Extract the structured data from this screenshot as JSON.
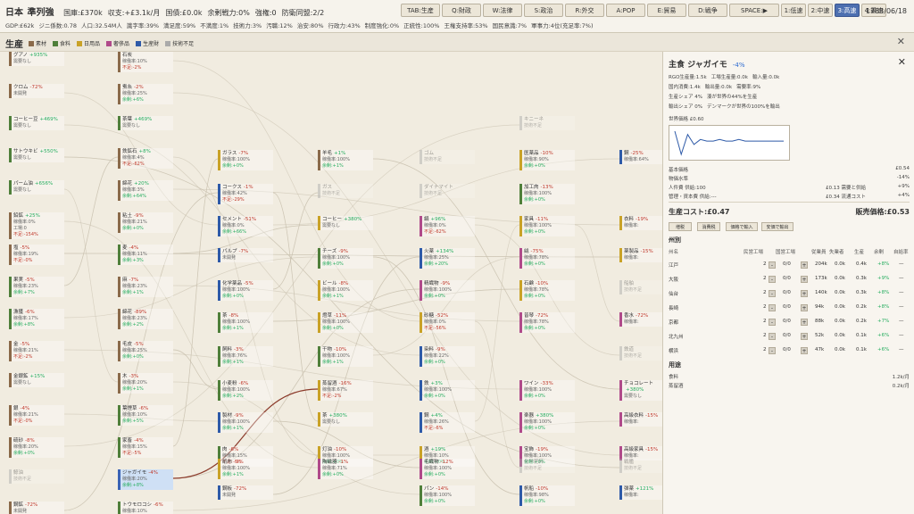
{
  "header": {
    "country": "日本",
    "rank": "準列強",
    "stats": [
      "国庫:£370k",
      "収支:+£3.1k/月",
      "国債:£0.0k",
      "余剰戦力:0%",
      "強権:0",
      "防衛同盟:2/2"
    ],
    "sub_stats": [
      "GDP:£62k",
      "ジニ係数:0.78",
      "人口:32.54M人",
      "識字率:39%",
      "満足度:59%",
      "不満度:1%",
      "技術力:3%",
      "汚職:12%",
      "治安:80%",
      "行政力:43%",
      "制度強化:0%",
      "正統性:100%",
      "王権支持率:53%",
      "国民意識:7%",
      "軍事力:4位(充足率:7%)"
    ],
    "buttons": [
      "TAB:生産",
      "Q:財政",
      "W:法律",
      "S:政治",
      "R:外交",
      "A:POP",
      "E:貿易",
      "D:戦争",
      "SPACE:▶",
      "1:低速",
      "2:中速",
      "3:高速",
      "4:最速"
    ],
    "active_button": "3:高速",
    "date": "1783/06/18"
  },
  "section": {
    "title": "生産",
    "legend": [
      {
        "label": "素材",
        "color": "#8a6a4a"
      },
      {
        "label": "食料",
        "color": "#4f7f3a"
      },
      {
        "label": "日用品",
        "color": "#c9a227"
      },
      {
        "label": "奢侈品",
        "color": "#b04a8a"
      },
      {
        "label": "生産財",
        "color": "#2e5aa8"
      },
      {
        "label": "技術不足",
        "color": "#aaaaaa"
      }
    ],
    "close": "✕"
  },
  "nodes": [
    {
      "name": "グアノ",
      "delta": "+935%",
      "lines": [
        "需要なし"
      ],
      "color": "#8a6a4a",
      "col": 0,
      "row": 0
    },
    {
      "name": "クロム",
      "delta": "-72%",
      "lines": [
        "未開発"
      ],
      "color": "#8a6a4a",
      "col": 0,
      "row": 1
    },
    {
      "name": "コーヒー豆",
      "delta": "+469%",
      "lines": [
        "需要なし"
      ],
      "color": "#4f7f3a",
      "col": 0,
      "row": 2
    },
    {
      "name": "サトウキビ",
      "delta": "+550%",
      "lines": [
        "需要なし"
      ],
      "color": "#4f7f3a",
      "col": 0,
      "row": 3
    },
    {
      "name": "パーム油",
      "delta": "+656%",
      "lines": [
        "需要なし"
      ],
      "color": "#4f7f3a",
      "col": 0,
      "row": 4
    },
    {
      "name": "鉛鉱",
      "delta": "+25%",
      "lines": [
        "稼働率:0%",
        "工場:0",
        "不足:-154%"
      ],
      "color": "#8a6a4a",
      "col": 0,
      "row": 5
    },
    {
      "name": "塩",
      "delta": "-5%",
      "lines": [
        "稼働率:19%",
        "不足:-0%"
      ],
      "color": "#8a6a4a",
      "col": 0,
      "row": 6
    },
    {
      "name": "果実",
      "delta": "-5%",
      "lines": [
        "稼働率:23%",
        "余剰:+7%"
      ],
      "color": "#4f7f3a",
      "col": 0,
      "row": 7
    },
    {
      "name": "漁獲",
      "delta": "-6%",
      "lines": [
        "稼働率:17%",
        "余剰:+8%"
      ],
      "color": "#4f7f3a",
      "col": 0,
      "row": 8
    },
    {
      "name": "金",
      "delta": "-5%",
      "lines": [
        "稼働率:21%",
        "不足:-2%"
      ],
      "color": "#8a6a4a",
      "col": 0,
      "row": 9
    },
    {
      "name": "金銀鉱",
      "delta": "+15%",
      "lines": [
        "需要なし"
      ],
      "color": "#8a6a4a",
      "col": 0,
      "row": 10
    },
    {
      "name": "銀",
      "delta": "-4%",
      "lines": [
        "稼働率:21%",
        "不足:-0%"
      ],
      "color": "#8a6a4a",
      "col": 0,
      "row": 11
    },
    {
      "name": "硫砂",
      "delta": "-8%",
      "lines": [
        "稼働率:20%",
        "余剰:+0%"
      ],
      "color": "#8a6a4a",
      "col": 0,
      "row": 12
    },
    {
      "name": "鯨油",
      "delta": "",
      "lines": [
        "技術不足"
      ],
      "color": "#aaaaaa",
      "col": 0,
      "row": 13,
      "dim": true
    },
    {
      "name": "鋼鉱",
      "delta": "-72%",
      "lines": [
        "未開発"
      ],
      "color": "#8a6a4a",
      "col": 0,
      "row": 14
    },
    {
      "name": "石炭",
      "delta": "",
      "lines": [
        "稼働率:10%",
        "不足:-2%"
      ],
      "color": "#8a6a4a",
      "col": 1,
      "row": 0
    },
    {
      "name": "蚕糸",
      "delta": "-2%",
      "lines": [
        "稼働率:25%",
        "余剰:+6%"
      ],
      "color": "#8a6a4a",
      "col": 1,
      "row": 1
    },
    {
      "name": "茶葉",
      "delta": "+469%",
      "lines": [
        "需要なし"
      ],
      "color": "#4f7f3a",
      "col": 1,
      "row": 2
    },
    {
      "name": "鉄鉱石",
      "delta": "+8%",
      "lines": [
        "稼働率:4%",
        "不足:-62%"
      ],
      "color": "#8a6a4a",
      "col": 1,
      "row": 3
    },
    {
      "name": "綿花",
      "delta": "+20%",
      "lines": [
        "稼働率:3%",
        "余剰:+64%"
      ],
      "color": "#8a6a4a",
      "col": 1,
      "row": 4
    },
    {
      "name": "粘土",
      "delta": "-9%",
      "lines": [
        "稼働率:21%",
        "余剰:+0%"
      ],
      "color": "#8a6a4a",
      "col": 1,
      "row": 5
    },
    {
      "name": "麦",
      "delta": "-4%",
      "lines": [
        "稼働率:11%",
        "余剰:+3%"
      ],
      "color": "#4f7f3a",
      "col": 1,
      "row": 6
    },
    {
      "name": "麻",
      "delta": "-7%",
      "lines": [
        "稼働率:23%",
        "余剰:+1%"
      ],
      "color": "#8a6a4a",
      "col": 1,
      "row": 7
    },
    {
      "name": "綿花",
      "delta": "-89%",
      "lines": [
        "稼働率:23%",
        "余剰:+2%"
      ],
      "color": "#8a6a4a",
      "col": 1,
      "row": 8
    },
    {
      "name": "毛皮",
      "delta": "-5%",
      "lines": [
        "稼働率:25%",
        "余剰:+0%"
      ],
      "color": "#8a6a4a",
      "col": 1,
      "row": 9
    },
    {
      "name": "木",
      "delta": "-3%",
      "lines": [
        "稼働率:20%",
        "余剰:+1%"
      ],
      "color": "#8a6a4a",
      "col": 1,
      "row": 10
    },
    {
      "name": "葉煙草",
      "delta": "-6%",
      "lines": [
        "稼働率:10%",
        "余剰:+5%"
      ],
      "color": "#4f7f3a",
      "col": 1,
      "row": 11
    },
    {
      "name": "家畜",
      "delta": "-4%",
      "lines": [
        "稼働率:15%",
        "不足:-5%"
      ],
      "color": "#4f7f3a",
      "col": 1,
      "row": 12
    },
    {
      "name": "ジャガイモ",
      "delta": "-4%",
      "lines": [
        "稼働率:20%",
        "余剰:+8%"
      ],
      "color": "#3a63b5",
      "col": 1,
      "row": 13,
      "sel": true
    },
    {
      "name": "トウモロコシ",
      "delta": "-6%",
      "lines": [
        "稼働率:10%",
        "余剰:+4%"
      ],
      "color": "#4f7f3a",
      "col": 1,
      "row": 14
    },
    {
      "name": "ガラス",
      "delta": "-7%",
      "lines": [
        "稼働率:100%",
        "余剰:+0%"
      ],
      "color": "#c9a227",
      "col": 2,
      "row": 3
    },
    {
      "name": "コークス",
      "delta": "-1%",
      "lines": [
        "稼働率:42%",
        "不足:-29%"
      ],
      "color": "#2e5aa8",
      "col": 2,
      "row": 4
    },
    {
      "name": "セメント",
      "delta": "-51%",
      "lines": [
        "稼働率:0%",
        "余剰:+66%"
      ],
      "color": "#2e5aa8",
      "col": 2,
      "row": 5
    },
    {
      "name": "パルプ",
      "delta": "-7%",
      "lines": [
        "未開発"
      ],
      "color": "#2e5aa8",
      "col": 2,
      "row": 6
    },
    {
      "name": "化学薬品",
      "delta": "-5%",
      "lines": [
        "稼働率:100%",
        "余剰:+0%"
      ],
      "color": "#2e5aa8",
      "col": 2,
      "row": 7
    },
    {
      "name": "茶",
      "delta": "-8%",
      "lines": [
        "稼働率:100%",
        "余剰:+1%"
      ],
      "color": "#4f7f3a",
      "col": 2,
      "row": 8
    },
    {
      "name": "飼料",
      "delta": "-3%",
      "lines": [
        "稼働率:76%",
        "余剰:+1%"
      ],
      "color": "#4f7f3a",
      "col": 2,
      "row": 9
    },
    {
      "name": "小麦粉",
      "delta": "-6%",
      "lines": [
        "稼働率:100%",
        "余剰:+2%"
      ],
      "color": "#4f7f3a",
      "col": 2,
      "row": 10
    },
    {
      "name": "製材",
      "delta": "-9%",
      "lines": [
        "稼働率:100%",
        "余剰:+1%"
      ],
      "color": "#2e5aa8",
      "col": 2,
      "row": 11
    },
    {
      "name": "肉",
      "delta": "-6%",
      "lines": [
        "稼働率:15%",
        "不足:-5%"
      ],
      "color": "#4f7f3a",
      "col": 2,
      "row": 12
    },
    {
      "name": "紙布",
      "delta": "-9%",
      "lines": [
        "稼働率:100%",
        "余剰:+1%"
      ],
      "color": "#c9a227",
      "col": 2,
      "row": 13
    },
    {
      "name": "鋼板",
      "delta": "-72%",
      "lines": [
        "未開発"
      ],
      "color": "#2e5aa8",
      "col": 2,
      "row": 14
    },
    {
      "name": "羊毛",
      "delta": "+1%",
      "lines": [
        "稼働率:100%",
        "余剰:+1%"
      ],
      "color": "#8a6a4a",
      "col": 3,
      "row": 3
    },
    {
      "name": "ガス",
      "delta": "",
      "lines": [
        "技術不足"
      ],
      "color": "#aaaaaa",
      "col": 3,
      "row": 4,
      "dim": true
    },
    {
      "name": "コーヒー",
      "delta": "+380%",
      "lines": [
        "需要なし"
      ],
      "color": "#c9a227",
      "col": 3,
      "row": 5
    },
    {
      "name": "チーズ",
      "delta": "-9%",
      "lines": [
        "稼働率:100%",
        "余剰:+0%"
      ],
      "color": "#4f7f3a",
      "col": 3,
      "row": 6
    },
    {
      "name": "ビール",
      "delta": "-8%",
      "lines": [
        "稼働率:100%",
        "余剰:+1%"
      ],
      "color": "#c9a227",
      "col": 3,
      "row": 7
    },
    {
      "name": "燈草",
      "delta": "-11%",
      "lines": [
        "稼働率:100%",
        "余剰:+0%"
      ],
      "color": "#c9a227",
      "col": 3,
      "row": 8
    },
    {
      "name": "干物",
      "delta": "-10%",
      "lines": [
        "稼働率:100%",
        "余剰:+1%"
      ],
      "color": "#4f7f3a",
      "col": 3,
      "row": 9
    },
    {
      "name": "蒸留酒",
      "delta": "-16%",
      "lines": [
        "稼働率:67%",
        "不足:-2%"
      ],
      "color": "#c9a227",
      "col": 3,
      "row": 10
    },
    {
      "name": "茶",
      "delta": "+380%",
      "lines": [
        "需要なし"
      ],
      "color": "#c9a227",
      "col": 3,
      "row": 11
    },
    {
      "name": "灯油",
      "delta": "-10%",
      "lines": [
        "稼働率:100%",
        "余剰:+0%"
      ],
      "color": "#c9a227",
      "col": 3,
      "row": 12
    },
    {
      "name": "陶磁器",
      "delta": "-1%",
      "lines": [
        "稼働率:71%",
        "余剰:+0%"
      ],
      "color": "#b04a8a",
      "col": 3,
      "row": 13
    },
    {
      "name": "ゴム",
      "delta": "",
      "lines": [
        "技術不足"
      ],
      "color": "#aaaaaa",
      "col": 4,
      "row": 3,
      "dim": true
    },
    {
      "name": "ダイナマイト",
      "delta": "",
      "lines": [
        "技術不足"
      ],
      "color": "#aaaaaa",
      "col": 4,
      "row": 4,
      "dim": true
    },
    {
      "name": "絹",
      "delta": "+96%",
      "lines": [
        "稼働率:0%",
        "不足:-62%"
      ],
      "color": "#b04a8a",
      "col": 4,
      "row": 5
    },
    {
      "name": "火薬",
      "delta": "+134%",
      "lines": [
        "稼働率:25%",
        "余剰:+20%"
      ],
      "color": "#2e5aa8",
      "col": 4,
      "row": 6
    },
    {
      "name": "精織物",
      "delta": "-9%",
      "lines": [
        "稼働率:100%",
        "余剰:+0%"
      ],
      "color": "#b04a8a",
      "col": 4,
      "row": 7
    },
    {
      "name": "砂糖",
      "delta": "-52%",
      "lines": [
        "稼働率:0%",
        "不足:-56%"
      ],
      "color": "#c9a227",
      "col": 4,
      "row": 8
    },
    {
      "name": "染料",
      "delta": "-9%",
      "lines": [
        "稼働率:22%",
        "余剰:+0%"
      ],
      "color": "#2e5aa8",
      "col": 4,
      "row": 9
    },
    {
      "name": "鉄",
      "delta": "+3%",
      "lines": [
        "稼働率:100%",
        "余剰:+0%"
      ],
      "color": "#2e5aa8",
      "col": 4,
      "row": 10
    },
    {
      "name": "鋼",
      "delta": "+4%",
      "lines": [
        "稼働率:26%",
        "不足:-6%"
      ],
      "color": "#2e5aa8",
      "col": 4,
      "row": 11
    },
    {
      "name": "酒",
      "delta": "+19%",
      "lines": [
        "稼働率:10%",
        "余剰:+0%"
      ],
      "color": "#c9a227",
      "col": 4,
      "row": 12
    },
    {
      "name": "毛織物",
      "delta": "-12%",
      "lines": [
        "稼働率:100%",
        "余剰:+0%"
      ],
      "color": "#b04a8a",
      "col": 4,
      "row": 13
    },
    {
      "name": "パン",
      "delta": "-14%",
      "lines": [
        "稼働率:100%",
        "余剰:+0%"
      ],
      "color": "#4f7f3a",
      "col": 4,
      "row": 14
    },
    {
      "name": "キニーネ",
      "delta": "",
      "lines": [
        "技術不足"
      ],
      "color": "#aaaaaa",
      "col": 5,
      "row": 2,
      "dim": true
    },
    {
      "name": "医薬品",
      "delta": "-10%",
      "lines": [
        "稼働率:90%",
        "余剰:+0%"
      ],
      "color": "#c9a227",
      "col": 5,
      "row": 3
    },
    {
      "name": "加工肉",
      "delta": "-13%",
      "lines": [
        "稼働率:100%",
        "余剰:+0%"
      ],
      "color": "#4f7f3a",
      "col": 5,
      "row": 4
    },
    {
      "name": "家具",
      "delta": "-11%",
      "lines": [
        "稼働率:100%",
        "余剰:+0%"
      ],
      "color": "#c9a227",
      "col": 5,
      "row": 5
    },
    {
      "name": "絨",
      "delta": "-75%",
      "lines": [
        "稼働率:78%",
        "余剰:+0%"
      ],
      "color": "#b04a8a",
      "col": 5,
      "row": 6
    },
    {
      "name": "石鹸",
      "delta": "-10%",
      "lines": [
        "稼働率:78%",
        "余剰:+0%"
      ],
      "color": "#c9a227",
      "col": 5,
      "row": 7
    },
    {
      "name": "皆琴",
      "delta": "-72%",
      "lines": [
        "稼働率:78%",
        "余剰:+0%"
      ],
      "color": "#b04a8a",
      "col": 5,
      "row": 8
    },
    {
      "name": "ワイン",
      "delta": "-33%",
      "lines": [
        "稼働率:100%",
        "余剰:+0%"
      ],
      "color": "#b04a8a",
      "col": 5,
      "row": 10
    },
    {
      "name": "楽器",
      "delta": "+380%",
      "lines": [
        "稼働率:100%",
        "余剰:+0%"
      ],
      "color": "#b04a8a",
      "col": 5,
      "row": 11
    },
    {
      "name": "宝飾",
      "delta": "-19%",
      "lines": [
        "稼働率:100%",
        "余剰:+0%"
      ],
      "color": "#b04a8a",
      "col": 5,
      "row": 12
    },
    {
      "name": "化学肥料",
      "delta": "",
      "lines": [
        "技術不足"
      ],
      "color": "#aaaaaa",
      "col": 5,
      "row": 13,
      "dim": true
    },
    {
      "name": "帆船",
      "delta": "-10%",
      "lines": [
        "稼働率:98%",
        "余剰:+0%"
      ],
      "color": "#2e5aa8",
      "col": 5,
      "row": 14
    },
    {
      "name": "鋼",
      "delta": "-25%",
      "lines": [
        "稼働率:64%"
      ],
      "color": "#2e5aa8",
      "col": 6,
      "row": 3
    },
    {
      "name": "衣料",
      "delta": "-19%",
      "lines": [
        "稼働率:"
      ],
      "color": "#c9a227",
      "col": 6,
      "row": 5
    },
    {
      "name": "薬製品",
      "delta": "-15%",
      "lines": [
        "稼働率:"
      ],
      "color": "#c9a227",
      "col": 6,
      "row": 6
    },
    {
      "name": "船舶",
      "delta": "",
      "lines": [
        "技術不足"
      ],
      "color": "#aaaaaa",
      "col": 6,
      "row": 7,
      "dim": true
    },
    {
      "name": "香水",
      "delta": "-72%",
      "lines": [
        "稼働率:"
      ],
      "color": "#b04a8a",
      "col": 6,
      "row": 8
    },
    {
      "name": "鉄道",
      "delta": "",
      "lines": [
        "技術不足"
      ],
      "color": "#aaaaaa",
      "col": 6,
      "row": 9,
      "dim": true
    },
    {
      "name": "チョコレート",
      "delta": "+380%",
      "lines": [
        "需要なし"
      ],
      "color": "#b04a8a",
      "col": 6,
      "row": 10
    },
    {
      "name": "高級衣料",
      "delta": "-15%",
      "lines": [
        "稼働率:"
      ],
      "color": "#b04a8a",
      "col": 6,
      "row": 11
    },
    {
      "name": "高級家具",
      "delta": "-15%",
      "lines": [
        "稼働率:"
      ],
      "color": "#b04a8a",
      "col": 6,
      "row": 12
    },
    {
      "name": "戦艦",
      "delta": "",
      "lines": [
        "技術不足"
      ],
      "color": "#aaaaaa",
      "col": 6,
      "row": 13,
      "dim": true
    },
    {
      "name": "弾薬",
      "delta": "+121%",
      "lines": [
        "稼働率:"
      ],
      "color": "#2e5aa8",
      "col": 6,
      "row": 14
    }
  ],
  "panel": {
    "category": "主食",
    "title": "ジャガイモ",
    "delta": "-4%",
    "info1": [
      "RGO生産量:1.5k",
      "工場生産量:0.0k",
      "輸入量:0.0k"
    ],
    "info2": [
      "国内消費:1.4k",
      "輸出量:0.0k",
      "需要率:9%"
    ],
    "info3": [
      "生産シェア 4%",
      "湊が世界の44%を生産"
    ],
    "info4": [
      "輸出シェア 0%",
      "デンマークが世界の100%を輸出"
    ],
    "world_price_label": "世界価格 £0.60",
    "price_history": [
      0.6,
      0.46,
      0.58,
      0.52,
      0.55,
      0.54,
      0.54,
      0.55,
      0.54,
      0.54,
      0.55,
      0.54,
      0.54,
      0.54,
      0.54,
      0.54,
      0.54,
      0.54
    ],
    "price_rows": [
      {
        "label": "基本価格",
        "value": "£0.54"
      },
      {
        "label": "物価水準",
        "value": "-14%"
      },
      {
        "label": "人件費 供給:100",
        "mid": "£0.13 需要と供給",
        "value": "+9%"
      },
      {
        "label": "管理・資本費 供給:---",
        "mid": "£0.34 流通コスト",
        "value": "+4%"
      }
    ],
    "cost": "生産コスト:£0.47",
    "sell": "販売価格:£0.53",
    "buttons": [
      "増税",
      "消費税",
      "価格で輸入",
      "安価で輸出"
    ],
    "states_title": "州別",
    "table_headers": [
      "州名",
      "民営工場",
      "国営工場",
      "従業員",
      "失業者",
      "生産",
      "余剰",
      "自給率"
    ],
    "states": [
      {
        "name": "江戸",
        "private": "2",
        "state": "0/0",
        "emp": "204k",
        "unemp": "0.0k",
        "prod": "0.4k",
        "surplus": "+8%",
        "self": "—"
      },
      {
        "name": "大阪",
        "private": "2",
        "state": "0/0",
        "emp": "173k",
        "unemp": "0.0k",
        "prod": "0.3k",
        "surplus": "+9%",
        "self": "—"
      },
      {
        "name": "仙台",
        "private": "2",
        "state": "0/0",
        "emp": "140k",
        "unemp": "0.0k",
        "prod": "0.3k",
        "surplus": "+8%",
        "self": "—"
      },
      {
        "name": "長崎",
        "private": "2",
        "state": "0/0",
        "emp": "94k",
        "unemp": "0.0k",
        "prod": "0.2k",
        "surplus": "+8%",
        "self": "—"
      },
      {
        "name": "京都",
        "private": "2",
        "state": "0/0",
        "emp": "88k",
        "unemp": "0.0k",
        "prod": "0.2k",
        "surplus": "+7%",
        "self": "—"
      },
      {
        "name": "北九州",
        "private": "2",
        "state": "0/0",
        "emp": "52k",
        "unemp": "0.0k",
        "prod": "0.1k",
        "surplus": "+6%",
        "self": "—"
      },
      {
        "name": "横浜",
        "private": "2",
        "state": "0/0",
        "emp": "47k",
        "unemp": "0.0k",
        "prod": "0.1k",
        "surplus": "+6%",
        "self": "—"
      }
    ],
    "uses_title": "用途",
    "uses": [
      {
        "name": "食料",
        "value": "1.2k/月"
      },
      {
        "name": "蒸留酒",
        "value": "0.2k/月"
      }
    ],
    "close": "✕"
  }
}
